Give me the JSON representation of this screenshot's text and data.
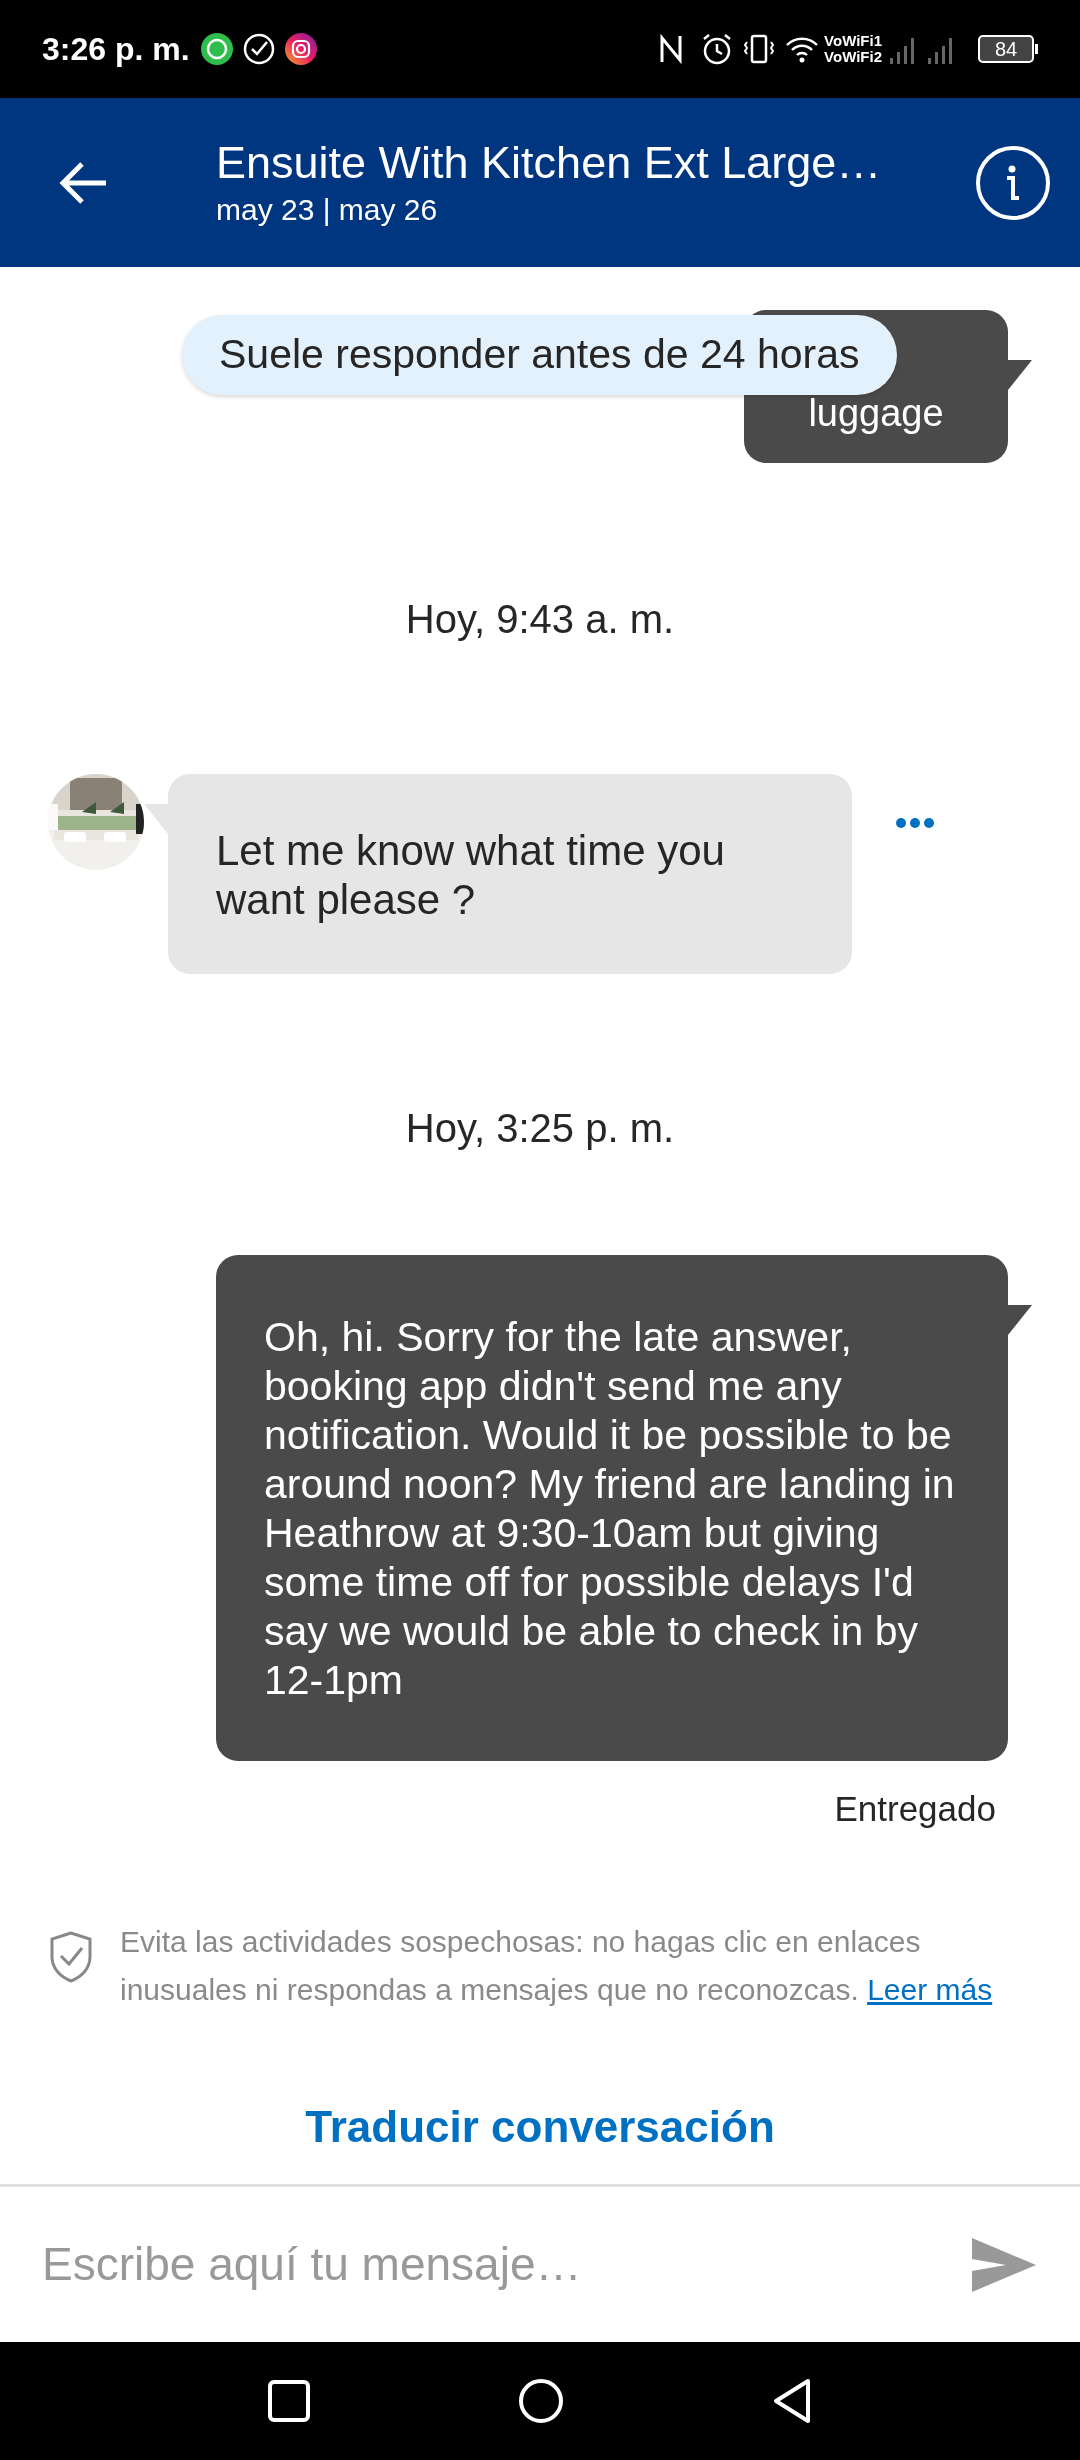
{
  "status_bar": {
    "time": "3:26 p. m.",
    "network_labels": [
      "VoWiFi1",
      "VoWiFi2"
    ],
    "battery": "84"
  },
  "header": {
    "title": "Ensuite With Kitchen Ext Large…",
    "subtitle": "may 23 | may 26"
  },
  "response_notice": "Suele responder antes de 24 horas",
  "messages": [
    {
      "kind": "sent",
      "text": "luggage"
    },
    {
      "kind": "time",
      "text": "Hoy, 9:43 a. m."
    },
    {
      "kind": "received",
      "text": "Let me know what time you want please ?"
    },
    {
      "kind": "time",
      "text": "Hoy, 3:25 p. m."
    },
    {
      "kind": "sent",
      "text": "Oh, hi. Sorry for the late answer, booking app didn't send me any notification. Would it be possible to be around noon? My friend are landing in Heathrow at 9:30-10am but giving some time off for possible delays I'd say we would be able to check in by 12-1pm"
    },
    {
      "kind": "status",
      "text": "Entregado"
    }
  ],
  "safety_notice": {
    "text": "Evita las actividades sospechosas: no hagas clic en enlaces inusuales ni respondas a mensajes que no reconozcas.",
    "link": "Leer más"
  },
  "translate_link": "Traducir conversación",
  "composer": {
    "placeholder": "Escribe aquí tu mensaje…"
  }
}
